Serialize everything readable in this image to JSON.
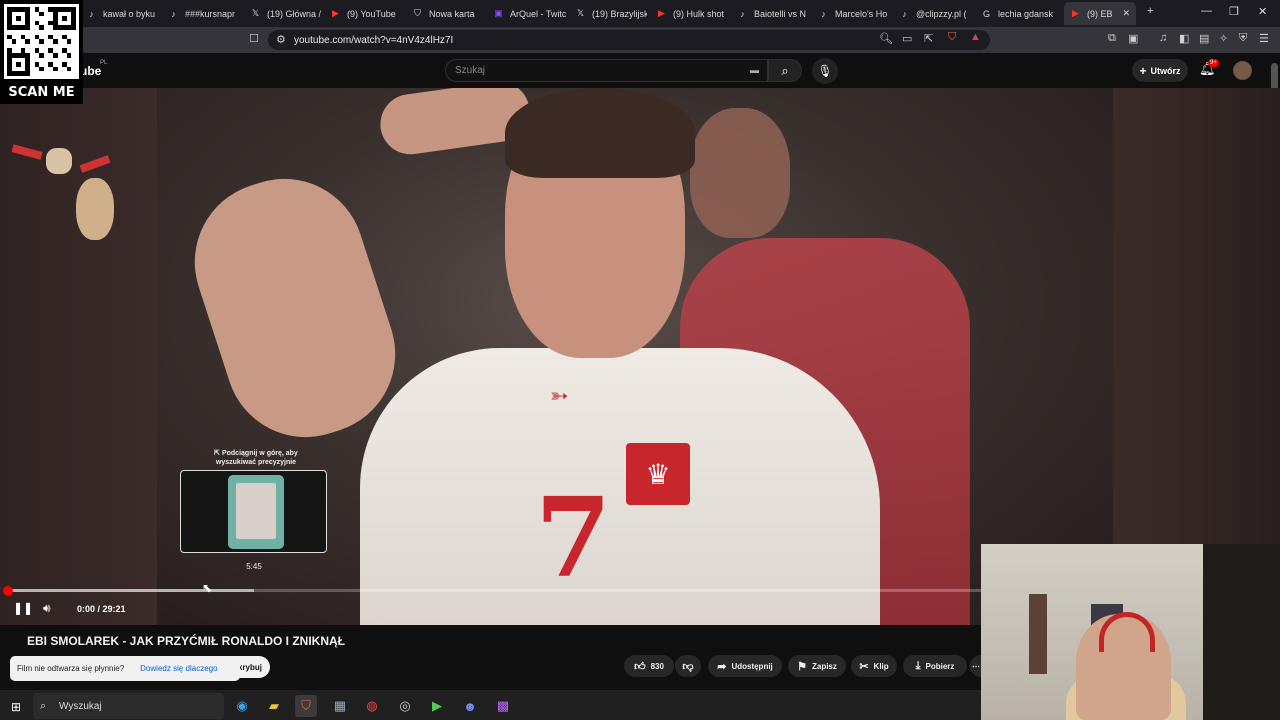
{
  "browser": {
    "tabs": [
      {
        "label": "kawał o byku",
        "icon": "tiktok-icon",
        "glyph": "♪"
      },
      {
        "label": "###kursnapr",
        "icon": "tiktok-icon",
        "glyph": "♪"
      },
      {
        "label": "(19) Główna /",
        "icon": "x-icon",
        "glyph": "𝕏"
      },
      {
        "label": "(9) YouTube",
        "icon": "youtube-icon",
        "glyph": "▶"
      },
      {
        "label": "Nowa karta",
        "icon": "brave-icon",
        "glyph": "⛉"
      },
      {
        "label": "ArQuel - Twitc",
        "icon": "twitch-icon",
        "glyph": "▣"
      },
      {
        "label": "(19) Brazylijsk",
        "icon": "x-icon",
        "glyph": "𝕏"
      },
      {
        "label": "(9) Hulk shot",
        "icon": "youtube-icon",
        "glyph": "▶"
      },
      {
        "label": "Baiotelli vs N",
        "icon": "tiktok-icon",
        "glyph": "♪"
      },
      {
        "label": "Marcelo's Ho",
        "icon": "tiktok-icon",
        "glyph": "♪"
      },
      {
        "label": "@clipzzy.pl (",
        "icon": "tiktok-icon",
        "glyph": "♪"
      },
      {
        "label": "lechia gdansk",
        "icon": "google-icon",
        "glyph": "G"
      },
      {
        "label": "(9) EB",
        "icon": "youtube-icon",
        "glyph": "▶"
      }
    ],
    "url": "youtube.com/watch?v=4nV4z4lHz7I"
  },
  "youtube": {
    "logo_suffix": "ube",
    "region": "PL",
    "search_placeholder": "Szukaj",
    "create_label": "Utwórz",
    "notifications_badge": "9+"
  },
  "overlay": {
    "scan_label": "SCAN ME",
    "seek_hint": "⇱ Podciągnij w górę, aby wyszukiwać precyzyjnie",
    "preview_time": "5:45"
  },
  "player": {
    "timecode": "0:00 / 29:21",
    "progress_fraction": 0.0,
    "hover_fraction": 0.254
  },
  "video": {
    "title": "EBI SMOLAREK - JAK PRZYĆMIŁ RONALDO I ZNIKNĄŁ",
    "likes": "830",
    "share_label": "Udostępnij",
    "save_label": "Zapisz",
    "clip_label": "Klip",
    "download_label": "Pobierz",
    "subscribe_label": "ubskrybuj"
  },
  "toast": {
    "message": "Film nie odtwarza się płynnie?",
    "link": "Dowiedz się dlaczego"
  },
  "taskbar": {
    "search_placeholder": "Wyszukaj"
  }
}
